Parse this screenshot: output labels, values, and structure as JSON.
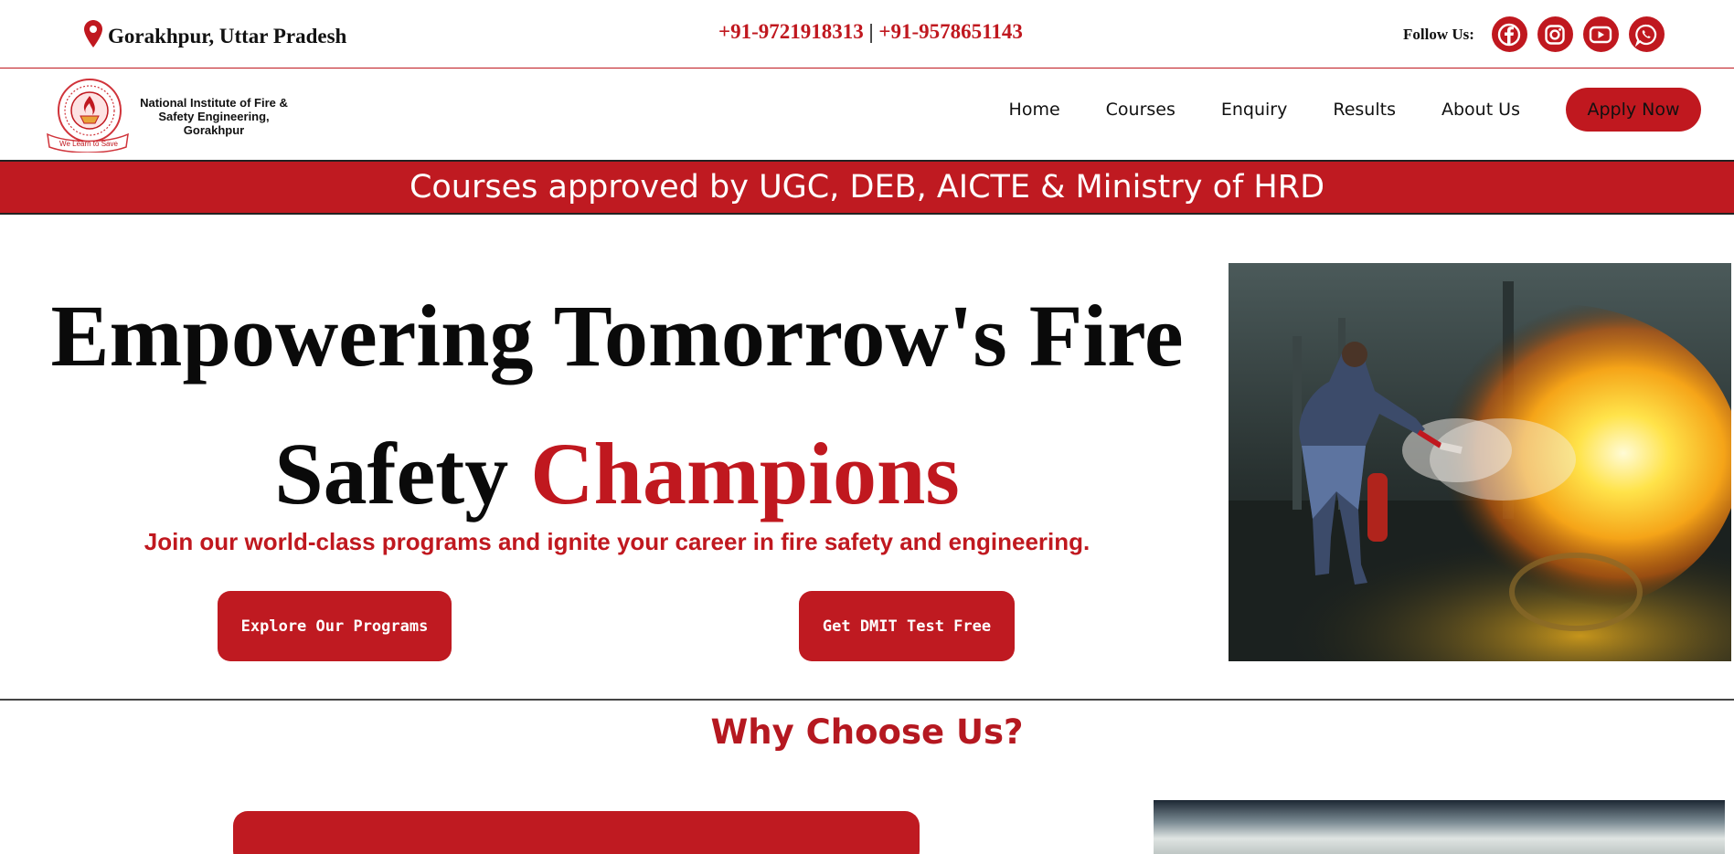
{
  "topbar": {
    "location": "Gorakhpur, Uttar Pradesh",
    "phone1": "+91-9721918313",
    "separator": " | ",
    "phone2": "+91-9578651143",
    "follow_label": "Follow Us:",
    "social": [
      "facebook-icon",
      "instagram-icon",
      "youtube-icon",
      "whatsapp-icon"
    ]
  },
  "header": {
    "logo_text": "National Institute of Fire & Safety Engineering, Gorakhpur",
    "logo_motto": "We Learn to Save",
    "nav": [
      "Home",
      "Courses",
      "Enquiry",
      "Results",
      "About Us"
    ],
    "apply_label": "Apply Now"
  },
  "banner": {
    "text": "Courses approved by UGC, DEB, AICTE & Ministry of HRD"
  },
  "hero": {
    "title_line1": "Empowering Tomorrow's Fire",
    "title_line2_plain": "Safety ",
    "title_line2_accent": "Champions",
    "subtitle": "Join our world-class programs and ignite your career in fire safety and engineering.",
    "btn_programs": "Explore Our Programs",
    "btn_dmit": "Get DMIT Test Free"
  },
  "why": {
    "title": "Why Choose Us?"
  },
  "colors": {
    "brand_red": "#c0181f",
    "text_dark": "#111111",
    "white": "#ffffff"
  }
}
